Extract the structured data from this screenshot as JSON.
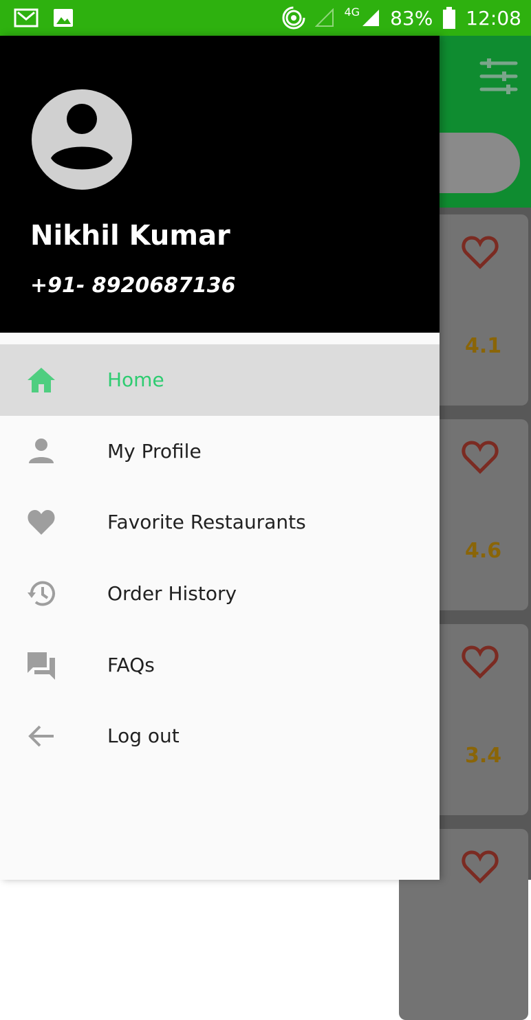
{
  "status_bar": {
    "battery": "83%",
    "time": "12:08",
    "network": "4G"
  },
  "drawer": {
    "user_name": "Nikhil Kumar",
    "user_phone": "+91- 8920687136",
    "menu": [
      {
        "label": "Home",
        "icon": "home-icon",
        "active": true
      },
      {
        "label": "My Profile",
        "icon": "person-icon"
      },
      {
        "label": "Favorite Restaurants",
        "icon": "heart-icon"
      },
      {
        "label": "Order History",
        "icon": "history-icon"
      },
      {
        "label": "FAQs",
        "icon": "forum-icon"
      },
      {
        "label": "Log out",
        "icon": "arrow-back-icon"
      }
    ]
  },
  "restaurants": [
    {
      "rating": "4.1"
    },
    {
      "rating": "4.6"
    },
    {
      "rating": "3.4"
    },
    {
      "rating": ""
    }
  ],
  "colors": {
    "status_bar": "#2eb10f",
    "accent_green": "#2ecc71",
    "header_bg": "#000000",
    "active_bg": "#dcdcdc"
  }
}
